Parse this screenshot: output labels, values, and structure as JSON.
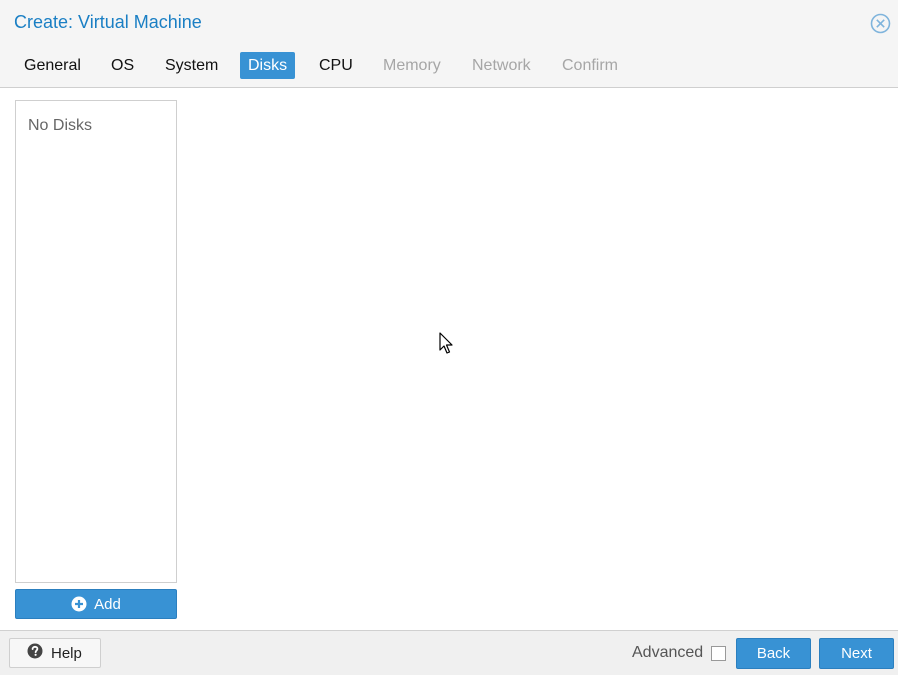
{
  "window": {
    "title": "Create: Virtual Machine",
    "close_icon": "close-circle-icon"
  },
  "tabs": [
    {
      "label": "General",
      "state": "enabled"
    },
    {
      "label": "OS",
      "state": "enabled"
    },
    {
      "label": "System",
      "state": "enabled"
    },
    {
      "label": "Disks",
      "state": "active"
    },
    {
      "label": "CPU",
      "state": "enabled"
    },
    {
      "label": "Memory",
      "state": "disabled"
    },
    {
      "label": "Network",
      "state": "disabled"
    },
    {
      "label": "Confirm",
      "state": "disabled"
    }
  ],
  "disks": {
    "empty_text": "No Disks",
    "add_label": "Add",
    "add_icon": "plus-circle-icon"
  },
  "footer": {
    "help_label": "Help",
    "help_icon": "question-circle-icon",
    "advanced_label": "Advanced",
    "advanced_checked": false,
    "back_label": "Back",
    "next_label": "Next"
  },
  "colors": {
    "accent": "#3892d4",
    "title": "#1a7fc4",
    "disabled_text": "#a6a6a6"
  }
}
